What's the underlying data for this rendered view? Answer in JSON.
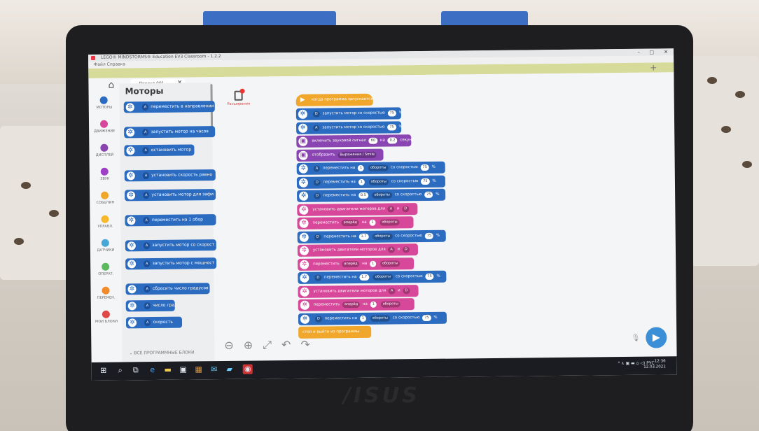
{
  "window": {
    "title": "LEGO® MINDSTORMS® Education EV3 Classroom - 1.2.2",
    "menu": "Файл Справка",
    "controls": [
      "–",
      "□",
      "✕"
    ]
  },
  "tab": {
    "label": "Проект 001",
    "close": "✕"
  },
  "palette": {
    "title": "Моторы",
    "all_blocks": "ВСЕ ПРОГРАММНЫЕ БЛОКИ",
    "categories": [
      {
        "label": "МОТОРЫ",
        "color": "#2b6bc0"
      },
      {
        "label": "ДВИЖЕНИЕ",
        "color": "#d8489a"
      },
      {
        "label": "ДИСПЛЕЙ",
        "color": "#8b45b3"
      },
      {
        "label": "ЗВУК",
        "color": "#9e3fc8"
      },
      {
        "label": "СОБЫТИЯ",
        "color": "#f0a72b"
      },
      {
        "label": "УПРАВЛ.",
        "color": "#f6b92d"
      },
      {
        "label": "ДАТЧИКИ",
        "color": "#47a7d8"
      },
      {
        "label": "ОПЕРАТ.",
        "color": "#5cb85c"
      },
      {
        "label": "ПЕРЕМЕН.",
        "color": "#f08a2a"
      },
      {
        "label": "МОИ БЛОКИ",
        "color": "#e04848"
      }
    ],
    "blocks": [
      {
        "port": "A",
        "text": "переместить в направлении"
      },
      {
        "port": "A",
        "text": "запустить мотор    на часов"
      },
      {
        "port": "A",
        "text": "остановить мотор"
      },
      {
        "port": "A",
        "text": "установить скорость равно"
      },
      {
        "port": "A",
        "text": "установить мотор для    зафи"
      },
      {
        "port": "A",
        "text": "переместить на  1  обор"
      },
      {
        "port": "A",
        "text": "запустить мотор со скорост"
      },
      {
        "port": "A",
        "text": "запустить мотор с мощност"
      },
      {
        "port": "A",
        "text": "сбросить число градусов"
      },
      {
        "port": "A",
        "text": "число градусов"
      },
      {
        "port": "A",
        "text": "скорость"
      }
    ]
  },
  "extension": {
    "label": "Расширения"
  },
  "program": {
    "start": "когда программа запускается",
    "blocks": [
      {
        "kind": "motor",
        "parts": [
          "D",
          "запустить мотор со скоростью",
          "75",
          "%"
        ]
      },
      {
        "kind": "motor",
        "parts": [
          "A",
          "запустить мотор со скоростью",
          "75",
          "%"
        ]
      },
      {
        "kind": "sound",
        "parts": [
          "",
          "включить звуковой сигнал",
          "60",
          "на",
          "0.2",
          "секунд"
        ]
      },
      {
        "kind": "sound",
        "parts": [
          "",
          "отобразить",
          "Выражения / Smile",
          ""
        ]
      },
      {
        "kind": "motor",
        "parts": [
          "A",
          "переместить на",
          "1",
          "обороты",
          "со скоростью",
          "75",
          "%"
        ]
      },
      {
        "kind": "motor",
        "parts": [
          "D",
          "переместить на",
          "1",
          "обороты",
          "со скоростью",
          "75",
          "%"
        ]
      },
      {
        "kind": "motor",
        "parts": [
          "D",
          "переместить на",
          "0.5",
          "обороты",
          "со скоростью",
          "75",
          "%"
        ]
      },
      {
        "kind": "move",
        "parts": [
          "",
          "установить двигатели моторов для",
          "A",
          "и",
          "D",
          ""
        ]
      },
      {
        "kind": "move",
        "parts": [
          "",
          "переместить",
          "вперёд",
          "на",
          "1",
          "обороты"
        ]
      },
      {
        "kind": "motor",
        "parts": [
          "D",
          "переместить на",
          "1.7",
          "обороты",
          "со скоростью",
          "75",
          "%"
        ]
      },
      {
        "kind": "move",
        "parts": [
          "",
          "установить двигатели моторов для",
          "A",
          "и",
          "D",
          ""
        ]
      },
      {
        "kind": "move",
        "parts": [
          "",
          "переместить",
          "вперёд",
          "на",
          "1",
          "обороты"
        ]
      },
      {
        "kind": "motor",
        "parts": [
          "D",
          "переместить на",
          "1.7",
          "обороты",
          "со скоростью",
          "75",
          "%"
        ]
      },
      {
        "kind": "move",
        "parts": [
          "",
          "установить двигатели моторов для",
          "A",
          "и",
          "D",
          ""
        ]
      },
      {
        "kind": "move",
        "parts": [
          "",
          "переместить",
          "вперёд",
          "на",
          "1",
          "обороты"
        ]
      },
      {
        "kind": "motor",
        "parts": [
          "D",
          "переместить на",
          "1",
          "обороты",
          "со скоростью",
          "75",
          "%"
        ]
      }
    ],
    "end": "стоп  и выйти из программы"
  },
  "taskbar": {
    "tray": "ᴿ ∧ ▣ ▬ ⌂ ◁) РУС",
    "time": "12:36",
    "date": "12.03.2021"
  },
  "device": {
    "brand": "/ISUS"
  }
}
